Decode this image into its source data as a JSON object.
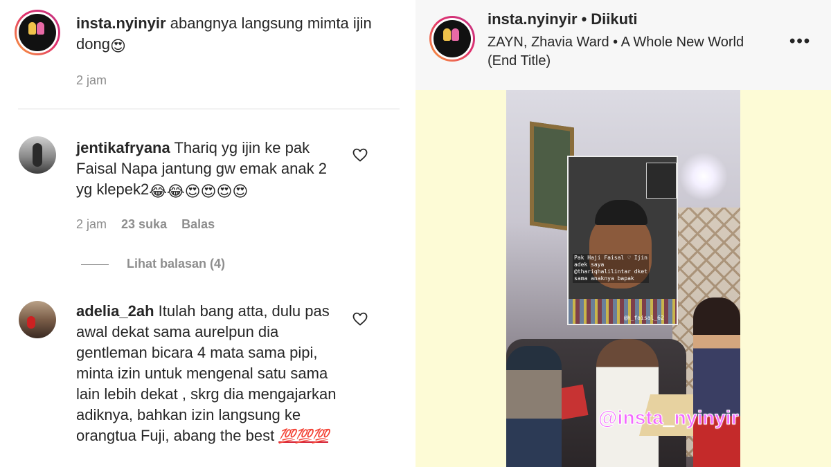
{
  "comments": [
    {
      "username": "insta.nyinyir",
      "text": "abangnya langsung mimta ijin dong",
      "emojis": "😍",
      "time": "2 jam"
    },
    {
      "username": "jentikafryana",
      "text": "Thariq yg ijin ke pak Faisal Napa jantung gw emak anak 2 yg klepek2",
      "emojis": "😂😂😍😍😍😍",
      "time": "2 jam",
      "likes": "23 suka",
      "reply_label": "Balas",
      "view_replies": "Lihat balasan (4)"
    },
    {
      "username": "adelia_2ah",
      "text": "Itulah bang atta, dulu pas awal dekat sama aurelpun dia gentleman bicara 4 mata sama pipi, minta izin untuk mengenal satu sama lain lebih dekat , skrg dia mengajarkan adiknya, bahkan izin langsung ke orangtua Fuji, abang the best",
      "emojis": "💯💯💯"
    }
  ],
  "post": {
    "username": "insta.nyinyir",
    "separator": "•",
    "follow_status": "Diikuti",
    "song": "ZAYN, Zhavia Ward • A Whole New World (End Title)",
    "more_label": "•••",
    "watermark": "@insta_nyinyir",
    "story_text": "Pak Haji Faisal ♡ Ijin adek saya @thariqhalilintar dket sama anaknya bapak",
    "story_tag": "@h_faisal_62"
  },
  "colors": {
    "ring_start": "#f9a13a",
    "ring_end": "#c13584",
    "meta_gray": "#8e8e8e",
    "video_bg": "#fdfbd6",
    "watermark": "#f36aff"
  },
  "icons": [
    "heart-icon",
    "more-icon"
  ]
}
